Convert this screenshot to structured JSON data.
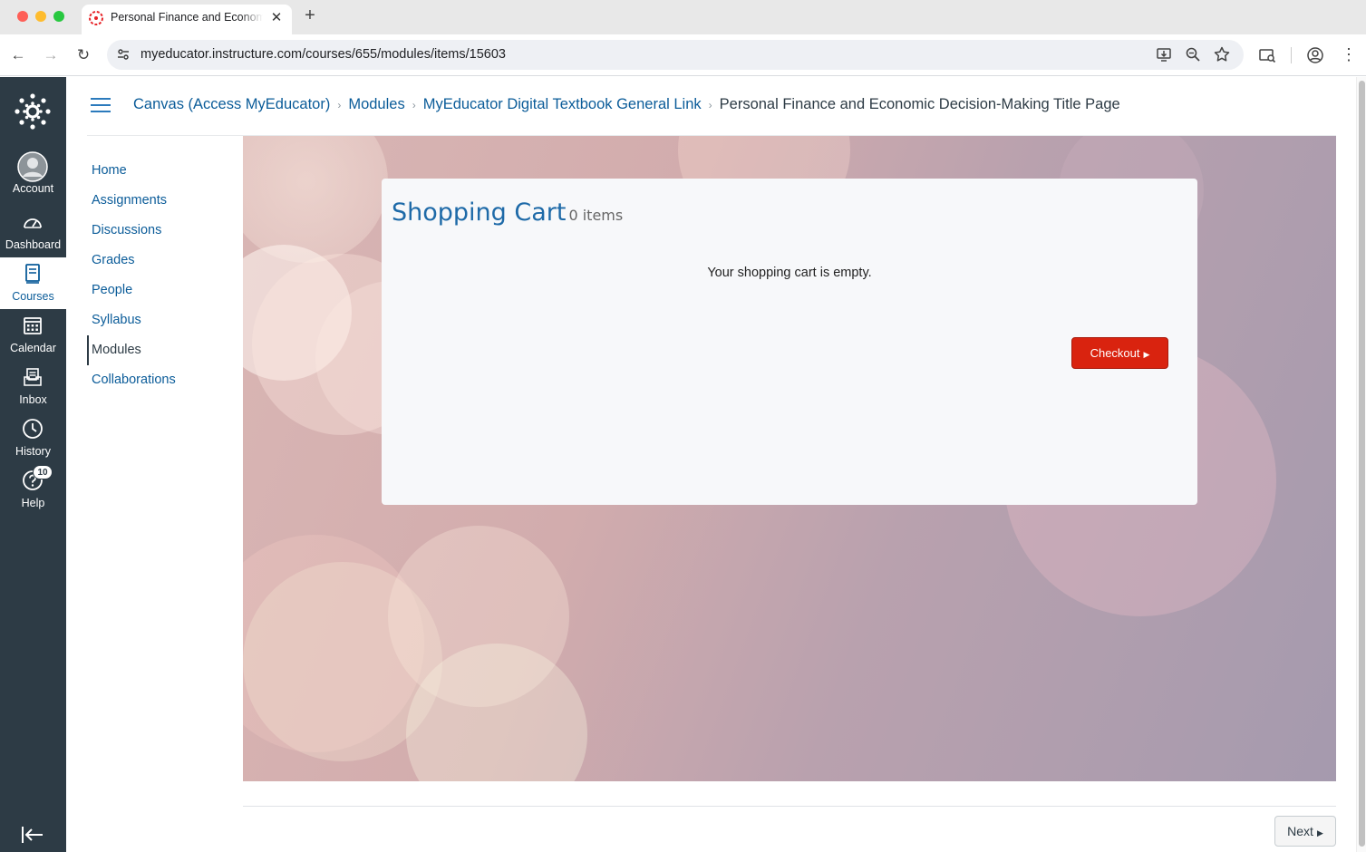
{
  "browser": {
    "tab_title": "Personal Finance and Economic Decision-Making Title Page",
    "url": "myeducator.instructure.com/courses/655/modules/items/15603"
  },
  "global_nav": {
    "items": [
      {
        "label": "Account",
        "icon": "user-avatar-icon"
      },
      {
        "label": "Dashboard",
        "icon": "dashboard-gauge-icon"
      },
      {
        "label": "Courses",
        "icon": "book-icon"
      },
      {
        "label": "Calendar",
        "icon": "calendar-icon"
      },
      {
        "label": "Inbox",
        "icon": "inbox-icon"
      },
      {
        "label": "History",
        "icon": "clock-icon"
      },
      {
        "label": "Help",
        "icon": "help-icon",
        "badge": "10"
      }
    ],
    "active": "Courses"
  },
  "breadcrumb": {
    "items": [
      "Canvas (Access MyEducator)",
      "Modules",
      "MyEducator Digital Textbook General Link"
    ],
    "current": "Personal Finance and Economic Decision-Making Title Page"
  },
  "course_nav": {
    "items": [
      "Home",
      "Assignments",
      "Discussions",
      "Grades",
      "People",
      "Syllabus",
      "Modules",
      "Collaborations"
    ],
    "active": "Modules"
  },
  "cart": {
    "title": "Shopping Cart",
    "count": "0 items",
    "empty_message": "Your shopping cart is empty.",
    "checkout_label": "Checkout"
  },
  "footer": {
    "next_label": "Next"
  },
  "colors": {
    "canvas_nav": "#2d3b45",
    "link": "#0b5c99",
    "checkout": "#d9230f"
  }
}
